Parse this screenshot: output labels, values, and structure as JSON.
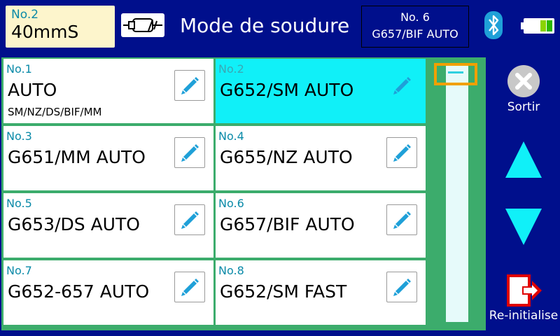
{
  "header": {
    "program_no": "No.2",
    "program_value": "40mmS",
    "title": "Mode de soudure",
    "fiber_no": "No. 6",
    "fiber_type": "G657/BIF AUTO",
    "icons": [
      "fiber-holder-icon",
      "bluetooth-icon",
      "battery-icon"
    ]
  },
  "modes": [
    {
      "no": "No.1",
      "name": "AUTO",
      "sub": "SM/NZ/DS/BIF/MM"
    },
    {
      "no": "No.2",
      "name": "G652/SM AUTO",
      "sub": ""
    },
    {
      "no": "No.3",
      "name": "G651/MM AUTO",
      "sub": ""
    },
    {
      "no": "No.4",
      "name": "G655/NZ AUTO",
      "sub": ""
    },
    {
      "no": "No.5",
      "name": "G653/DS AUTO",
      "sub": ""
    },
    {
      "no": "No.6",
      "name": "G657/BIF AUTO",
      "sub": ""
    },
    {
      "no": "No.7",
      "name": "G652-657 AUTO",
      "sub": ""
    },
    {
      "no": "No.8",
      "name": "G652/SM FAST",
      "sub": ""
    }
  ],
  "selected_index": 1,
  "controls": {
    "exit_label": "Sortir",
    "reset_label": "Re-initialise"
  },
  "colors": {
    "background": "#000f8c",
    "panel": "#3cac6c",
    "selected": "#10f0f8",
    "accent": "#1fa0d8",
    "scroll_thumb_border": "#f0a000"
  }
}
